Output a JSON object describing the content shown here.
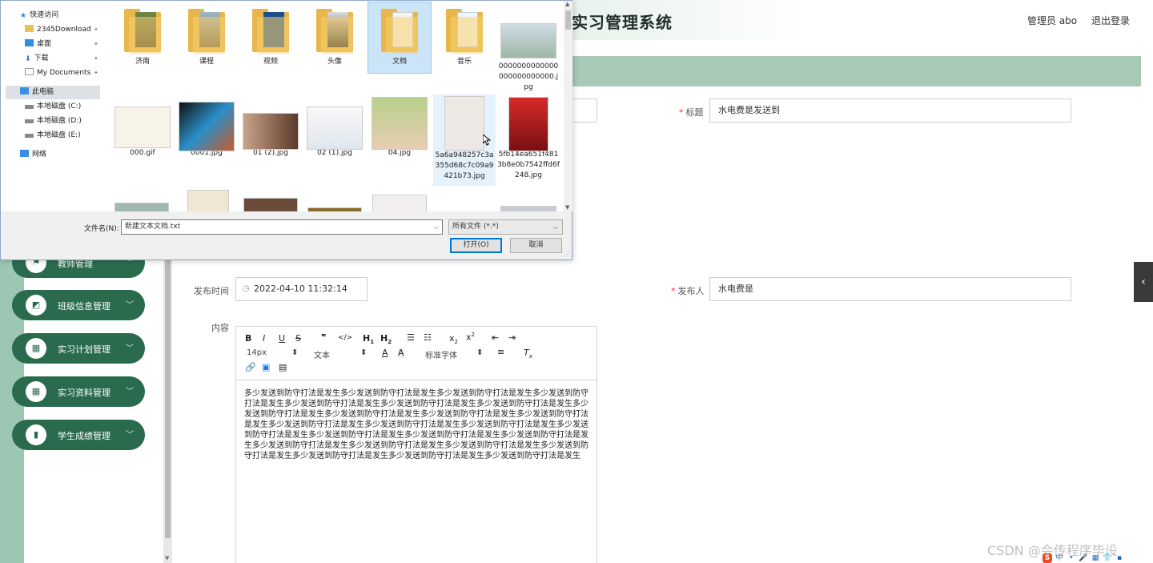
{
  "app": {
    "title": "实习管理系统",
    "user": "管理员 abo",
    "logout": "退出登录"
  },
  "sidebar": {
    "items": [
      {
        "label": "教师管理",
        "icon": "flag-icon"
      },
      {
        "label": "班级信息管理",
        "icon": "chart-icon"
      },
      {
        "label": "实习计划管理",
        "icon": "grid-icon"
      },
      {
        "label": "实习资料管理",
        "icon": "grid-icon"
      },
      {
        "label": "学生成绩管理",
        "icon": "bar-chart-icon"
      }
    ]
  },
  "form": {
    "title_label": "标题",
    "title_value": "水电费是发送到",
    "publish_time_label": "发布时间",
    "publish_time_value": "2022-04-10 11:32:14",
    "publisher_label": "发布人",
    "publisher_value": "水电费是",
    "content_label": "内容",
    "required_mark": "*",
    "editor": {
      "font_size": "14px",
      "text_type": "文本",
      "font_family": "标准字体",
      "body": "多少发送到防守打法是发生多少发送到防守打法是发生多少发送到防守打法是发生多少发送到防守打法是发生多少发送到防守打法是发生多少发送到防守打法是发生多少发送到防守打法是发生多少发送到防守打法是发生多少发送到防守打法是发生多少发送到防守打法是发生多少发送到防守打法是发生多少发送到防守打法是发生多少发送到防守打法是发生多少发送到防守打法是发生多少发送到防守打法是发生多少发送到防守打法是发生多少发送到防守打法是发生多少发送到防守打法是发生多少发送到防守打法是发生多少发送到防守打法是发生多少发送到防守打法是发生多少发送到防守打法是发生多少发送到防守打法是发生多少发送到防守打法是发生多少发送到防守打法是发生"
    }
  },
  "dialog": {
    "nav": [
      {
        "label": "快速访问",
        "icon": "star-icon"
      },
      {
        "label": "2345Download",
        "icon": "folder-icon",
        "pinned": true
      },
      {
        "label": "桌面",
        "icon": "desktop-icon",
        "pinned": true
      },
      {
        "label": "下载",
        "icon": "download-icon",
        "pinned": true
      },
      {
        "label": "My Documents",
        "icon": "document-icon",
        "pinned": true
      },
      {
        "label": "此电脑",
        "icon": "computer-icon"
      },
      {
        "label": "本地磁盘 (C:)",
        "icon": "drive-icon"
      },
      {
        "label": "本地磁盘 (D:)",
        "icon": "drive-icon"
      },
      {
        "label": "本地磁盘 (E:)",
        "icon": "drive-icon"
      },
      {
        "label": "网络",
        "icon": "network-icon"
      }
    ],
    "files": [
      {
        "name": "济南"
      },
      {
        "name": "课程"
      },
      {
        "name": "视频"
      },
      {
        "name": "头像"
      },
      {
        "name": "文档"
      },
      {
        "name": "音乐"
      },
      {
        "name": "0000000000000000000000000.jpg"
      },
      {
        "name": "000.gif"
      },
      {
        "name": "0001.jpg"
      },
      {
        "name": "01 (2).jpg"
      },
      {
        "name": "02 (1).jpg"
      },
      {
        "name": "04.jpg"
      },
      {
        "name": "5a6a948257c3a355d68c7c09a9421b73.jpg"
      },
      {
        "name": "5fb14ea651f4813b8e0b7542ffd6f248.jpg"
      }
    ],
    "filename_label": "文件名(N):",
    "filename_value": "新建文本文档.txt",
    "filetype_value": "所有文件 (*.*)",
    "open_button": "打开(O)",
    "cancel_button": "取消"
  },
  "watermark": "CSDN @会传程序毕设",
  "ime": {
    "logo": "S",
    "mode": "中"
  },
  "colors": {
    "accent": "#2a6b4d",
    "header_bar": "#a7c9b5",
    "selection": "#cce4f7"
  }
}
